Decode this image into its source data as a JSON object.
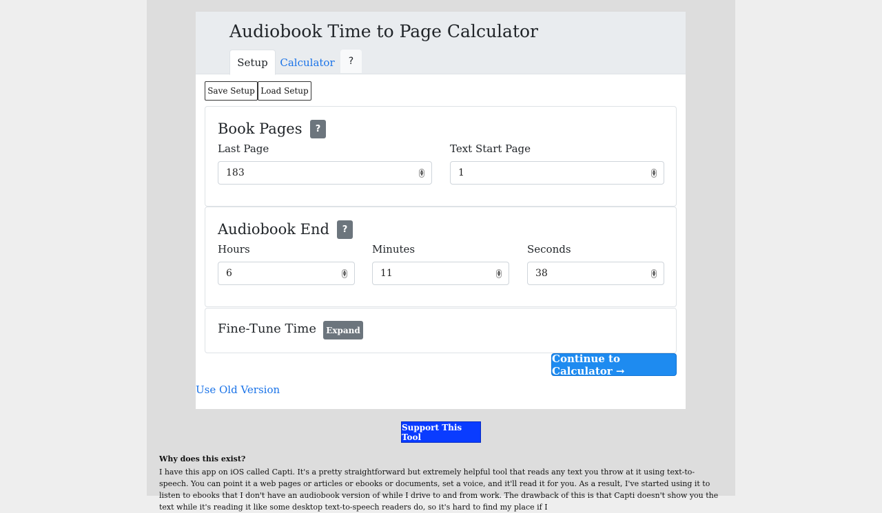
{
  "app": {
    "title": "Audiobook Time to Page Calculator"
  },
  "tabs": {
    "setup": "Setup",
    "calculator": "Calculator",
    "help": "?"
  },
  "toolbar": {
    "save": "Save Setup",
    "load": "Load Setup"
  },
  "book_pages": {
    "title": "Book Pages",
    "help": "?",
    "last_page_label": "Last Page",
    "last_page_value": "183",
    "text_start_label": "Text Start Page",
    "text_start_value": "1"
  },
  "audiobook_end": {
    "title": "Audiobook End",
    "help": "?",
    "hours_label": "Hours",
    "hours_value": "6",
    "minutes_label": "Minutes",
    "minutes_value": "11",
    "seconds_label": "Seconds",
    "seconds_value": "38"
  },
  "fine_tune": {
    "title": "Fine-Tune Time",
    "expand": "Expand"
  },
  "continue_label": "Continue to Calculator →",
  "old_version": "Use Old Version",
  "support": "Support This Tool",
  "why": {
    "title": "Why does this exist?",
    "body": "I have this app on iOS called Capti. It's a pretty straightforward but extremely helpful tool that reads any text you throw at it using text-to-speech. You can point it a web pages or articles or ebooks or documents, set a voice, and it'll read it for you. As a result, I've started using it to listen to ebooks that I don't have an audiobook version of while I drive to and from work. The drawback of this is that Capti doesn't show you the text while it's reading it like some desktop text-to-speech readers do, so it's hard to find my place if I"
  },
  "icons": {
    "spinner": "number-spinner-icon"
  }
}
